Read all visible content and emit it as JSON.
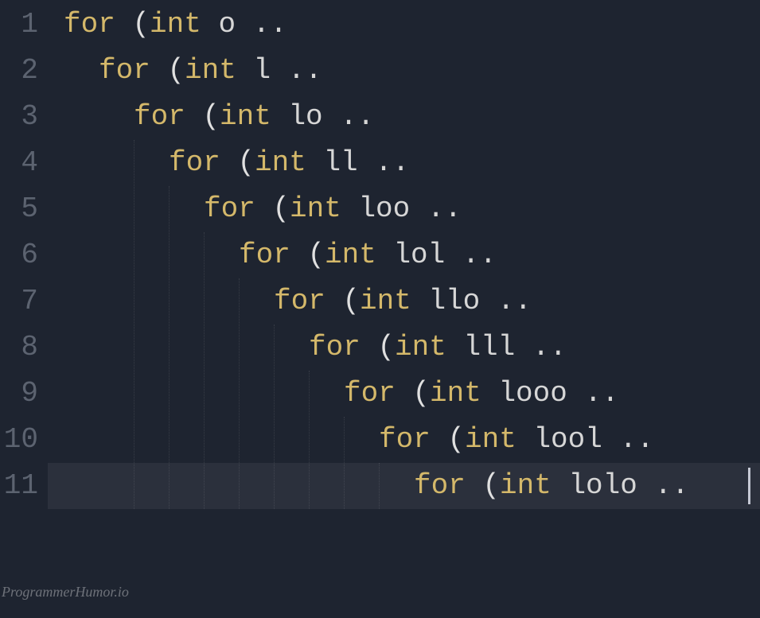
{
  "editor": {
    "lines": [
      {
        "num": "1",
        "indent": 0,
        "keyword": "for",
        "paren": "(",
        "type": "int",
        "var": "o",
        "tail": " .."
      },
      {
        "num": "2",
        "indent": 1,
        "keyword": "for",
        "paren": "(",
        "type": "int",
        "var": "l",
        "tail": " .."
      },
      {
        "num": "3",
        "indent": 2,
        "keyword": "for",
        "paren": "(",
        "type": "int",
        "var": "lo",
        "tail": " .."
      },
      {
        "num": "4",
        "indent": 3,
        "keyword": "for",
        "paren": "(",
        "type": "int",
        "var": "ll",
        "tail": " .."
      },
      {
        "num": "5",
        "indent": 4,
        "keyword": "for",
        "paren": "(",
        "type": "int",
        "var": "loo",
        "tail": " .."
      },
      {
        "num": "6",
        "indent": 5,
        "keyword": "for",
        "paren": "(",
        "type": "int",
        "var": "lol",
        "tail": " .."
      },
      {
        "num": "7",
        "indent": 6,
        "keyword": "for",
        "paren": "(",
        "type": "int",
        "var": "llo",
        "tail": " .."
      },
      {
        "num": "8",
        "indent": 7,
        "keyword": "for",
        "paren": "(",
        "type": "int",
        "var": "lll",
        "tail": " .."
      },
      {
        "num": "9",
        "indent": 8,
        "keyword": "for",
        "paren": "(",
        "type": "int",
        "var": "looo",
        "tail": " .."
      },
      {
        "num": "10",
        "indent": 9,
        "keyword": "for",
        "paren": "(",
        "type": "int",
        "var": "lool",
        "tail": " .."
      },
      {
        "num": "11",
        "indent": 10,
        "keyword": "for",
        "paren": "(",
        "type": "int",
        "var": "lolo",
        "tail": " .."
      }
    ],
    "highlight_row": 10,
    "indent_size_px": 44,
    "line_height_px": 58
  },
  "watermark": "ProgrammerHumor.io"
}
